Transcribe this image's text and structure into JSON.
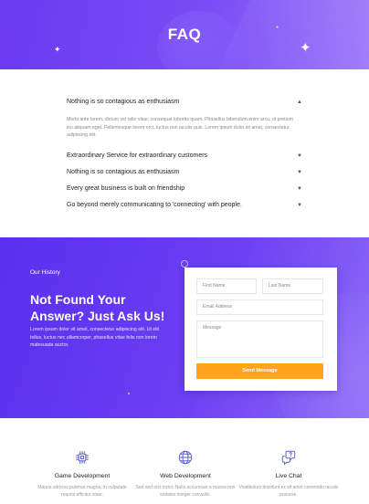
{
  "hero": {
    "title": "FAQ"
  },
  "faq": {
    "open": {
      "question": "Nothing is so contagious as enthusiasm",
      "answer": "Morbi ante lorem, dictum vel odio vitae, consequat lobortis quam. Phasellus bibendum enim arcu, ut pretium leo aliquam eget. Pellentesque lorem orci, luctus non iaculis quis. Lorem ipsum dolor sit amet, consectetur adipiscing elit."
    },
    "closed": [
      "Extraordinary Service for extraordinary customers",
      "Nothing is so contagious as enthusiasm",
      "Every great business is built on friendship",
      "Go beyond merely communicating to 'connecting' with people."
    ]
  },
  "contact": {
    "eyebrow": "Our History",
    "heading": "Not Found Your Answer? Just Ask Us!",
    "lede": "Lorem ipsum dolor sit amet, consectetur adipiscing elit. Ut elit tellus, luctus nec ullamcorper, phasellus vitae felis non lorem malesuada auctor.",
    "form": {
      "first_name": "First Name",
      "last_name": "Last Name",
      "email": "Email Address",
      "message": "Message",
      "send": "Send Message"
    }
  },
  "services": [
    {
      "icon": "game-development-icon",
      "title": "Game Development",
      "desc": "Mauris ultricies pulvinar magna, in vulputate mauris efficitur vitae."
    },
    {
      "icon": "globe-icon",
      "title": "Web Development",
      "desc": "Sed sed orci tortor. Nulla accumsan a massa non sodales integer convallis."
    },
    {
      "icon": "chat-bubbles-icon",
      "title": "Live Chat",
      "desc": "Vestibulum tincidunt ex sit amet commodo iaculis posuere."
    }
  ],
  "colors": {
    "primary": "#6a39f0",
    "accent": "#ffa41b"
  }
}
